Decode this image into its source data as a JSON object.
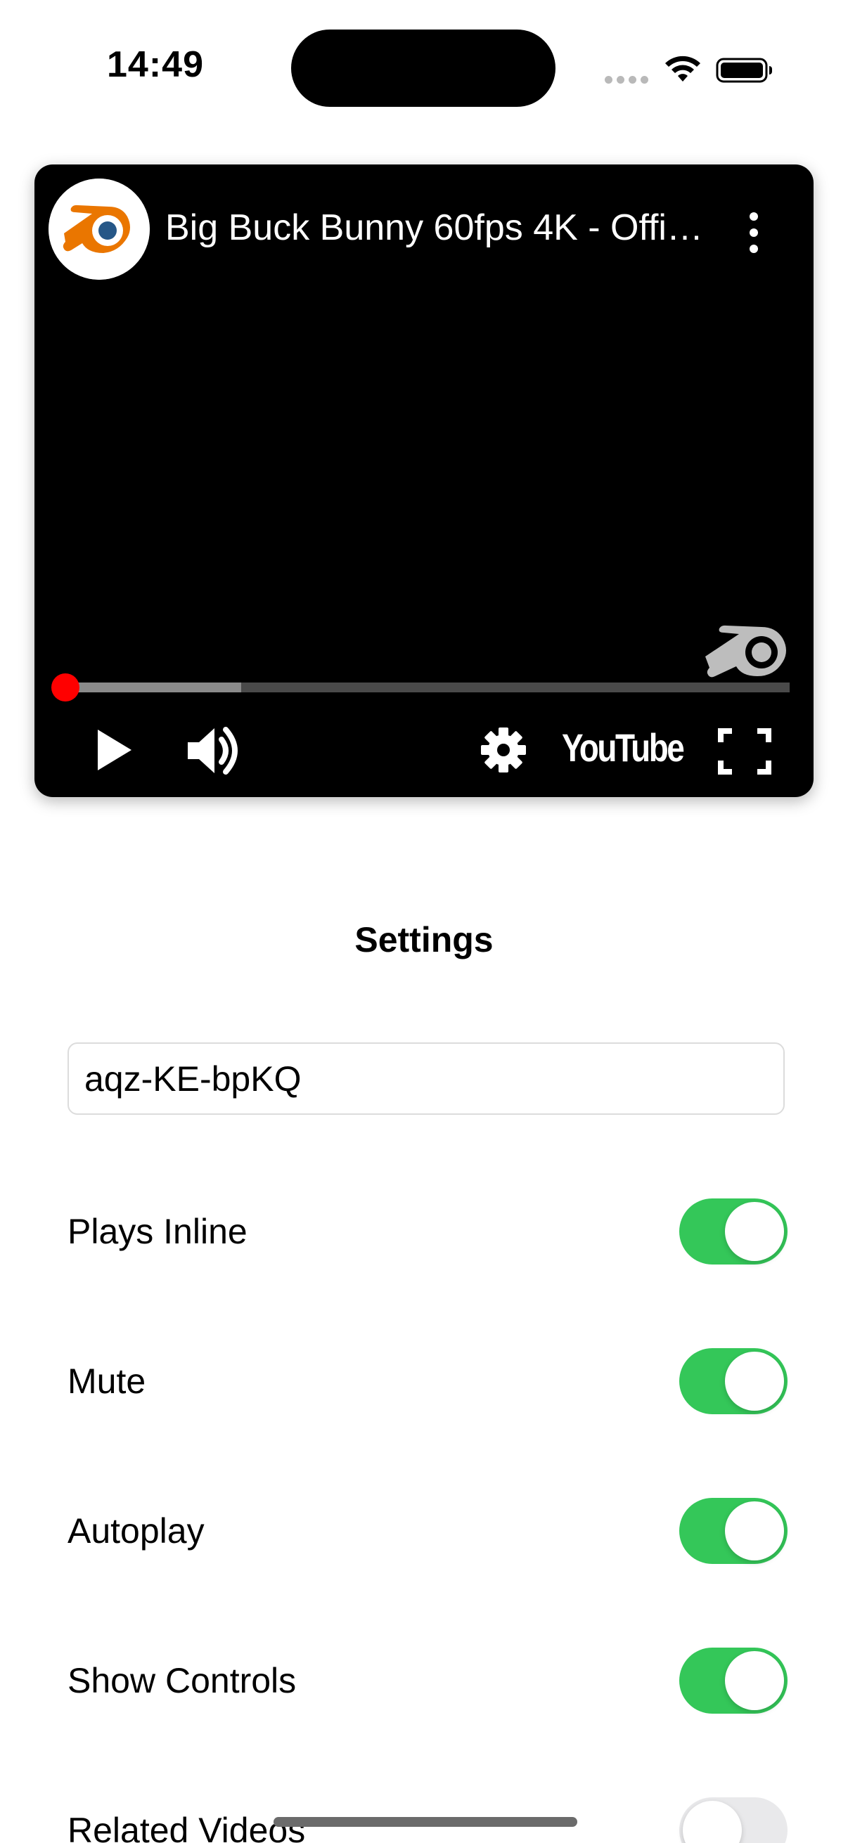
{
  "status_bar": {
    "time": "14:49"
  },
  "player": {
    "title": "Big Buck Bunny 60fps 4K - Offi…",
    "channel_icon": "blender-logo-icon",
    "watermark_icon": "blender-logo-icon",
    "progress": {
      "played_fraction": 0.01,
      "buffered_fraction": 0.25
    },
    "controls": {
      "play_icon": "play-icon",
      "volume_icon": "volume-icon",
      "settings_icon": "gear-icon",
      "brand": "YouTube",
      "fullscreen_icon": "fullscreen-icon"
    },
    "colors": {
      "progress": "#ff0000",
      "background": "#000000"
    }
  },
  "settings": {
    "title": "Settings",
    "video_id": "aqz-KE-bpKQ",
    "toggles": [
      {
        "label": "Plays Inline",
        "on": true
      },
      {
        "label": "Mute",
        "on": true
      },
      {
        "label": "Autoplay",
        "on": true
      },
      {
        "label": "Show Controls",
        "on": true
      },
      {
        "label": "Related Videos",
        "on": false
      }
    ],
    "colors": {
      "switch_on": "#34c759",
      "switch_off": "#e9e9eb"
    }
  }
}
